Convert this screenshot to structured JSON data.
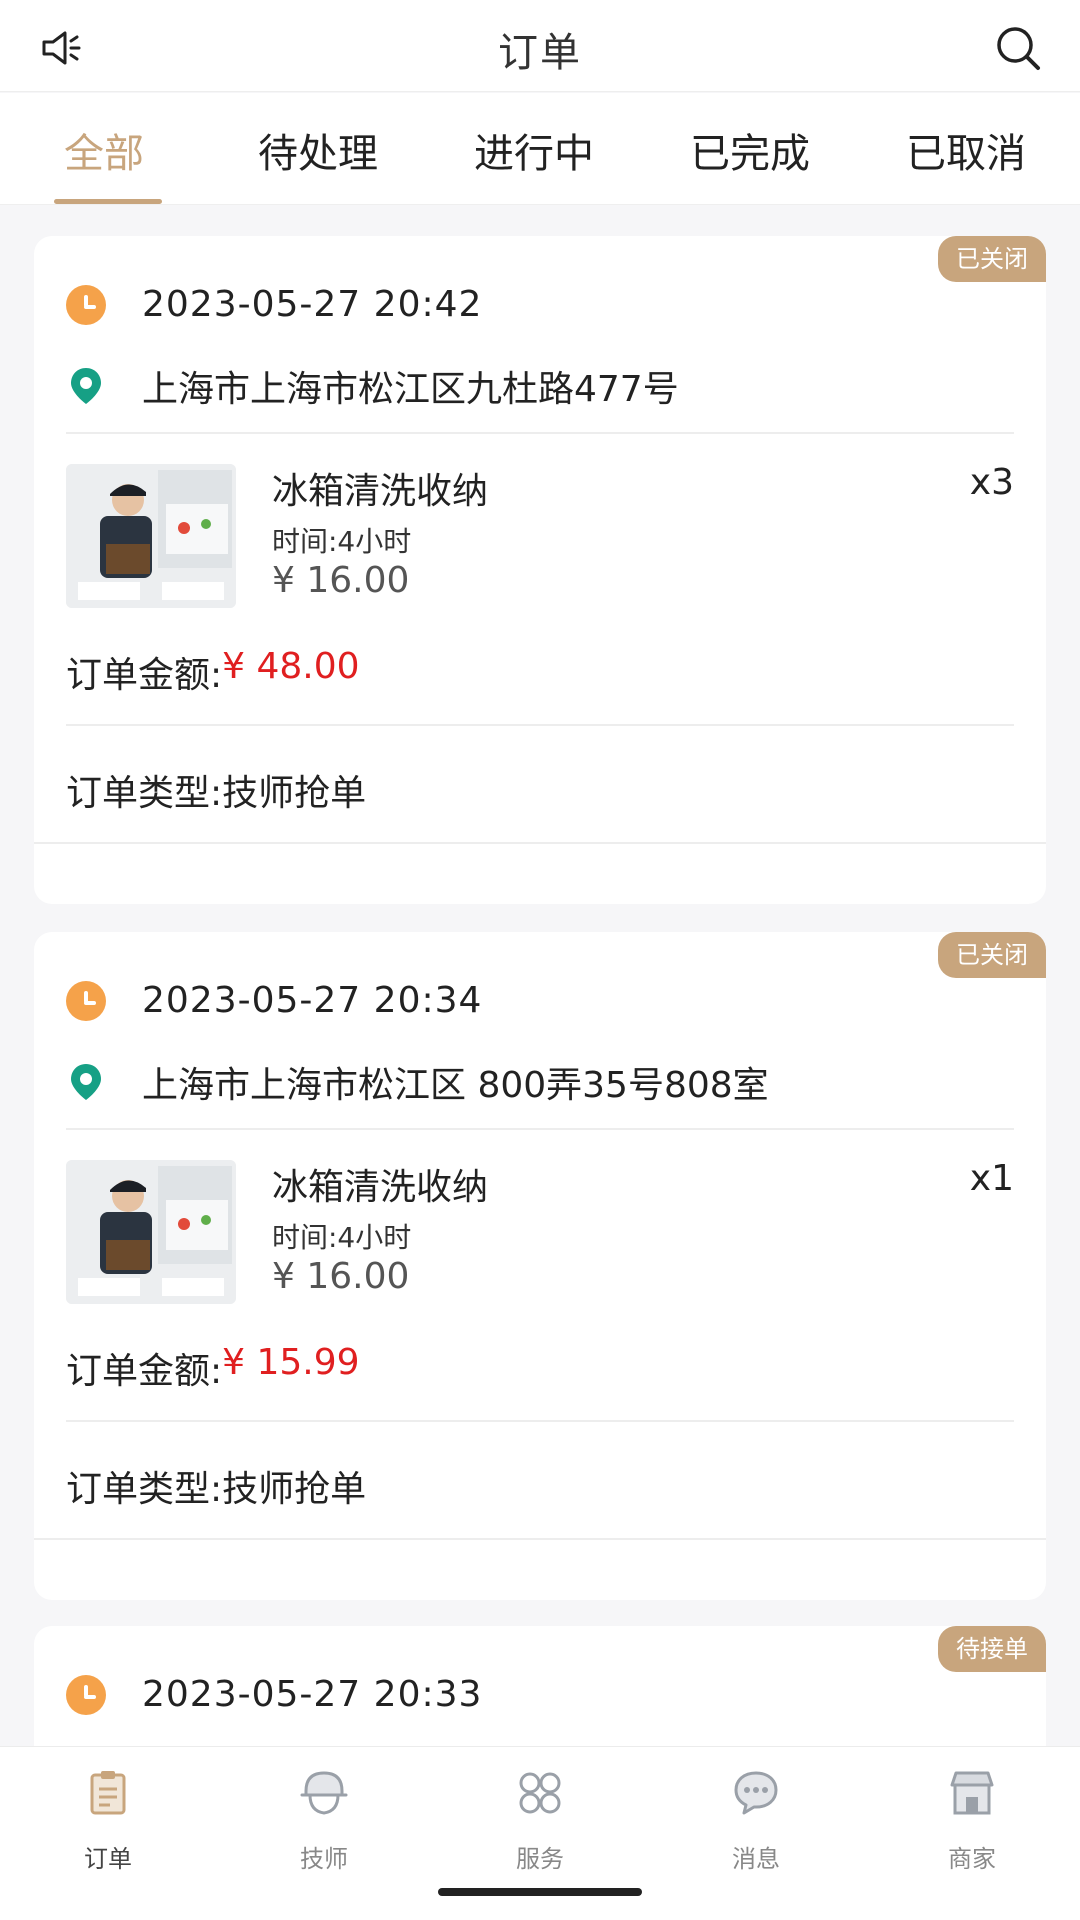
{
  "header": {
    "title": "订单",
    "left_icon": "speaker-icon",
    "right_icon": "search-icon"
  },
  "tabs": [
    {
      "label": "全部",
      "active": true
    },
    {
      "label": "待处理",
      "active": false
    },
    {
      "label": "进行中",
      "active": false
    },
    {
      "label": "已完成",
      "active": false
    },
    {
      "label": "已取消",
      "active": false
    }
  ],
  "orders": [
    {
      "status": "已关闭",
      "time": "2023-05-27 20:42",
      "address": "上海市上海市松江区九杜路477号",
      "product": {
        "name": "冰箱清洗收纳",
        "duration": "时间:4小时",
        "price": "¥ 16.00",
        "qty": "x3"
      },
      "amount_label": "订单金额:",
      "amount": "¥ 48.00",
      "type_label": "订单类型:",
      "type": "技师抢单"
    },
    {
      "status": "已关闭",
      "time": "2023-05-27 20:34",
      "address": "上海市上海市松江区 800弄35号808室",
      "product": {
        "name": "冰箱清洗收纳",
        "duration": "时间:4小时",
        "price": "¥ 16.00",
        "qty": "x1"
      },
      "amount_label": "订单金额:",
      "amount": "¥ 15.99",
      "type_label": "订单类型:",
      "type": "技师抢单"
    },
    {
      "status": "待接单",
      "time": "2023-05-27 20:33"
    }
  ],
  "bottom_nav": [
    {
      "label": "订单",
      "icon": "order-icon",
      "active": true
    },
    {
      "label": "技师",
      "icon": "technician-icon",
      "active": false
    },
    {
      "label": "服务",
      "icon": "service-icon",
      "active": false
    },
    {
      "label": "消息",
      "icon": "message-icon",
      "active": false
    },
    {
      "label": "商家",
      "icon": "store-icon",
      "active": false
    }
  ],
  "colors": {
    "accent": "#c8a57d",
    "price_red": "#e01f20",
    "clock_orange": "#f5a24a",
    "pin_green": "#16a085"
  }
}
